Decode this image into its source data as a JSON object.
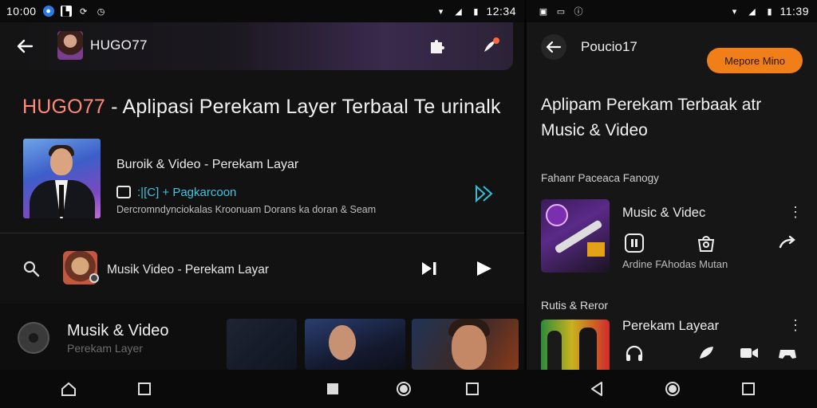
{
  "status_left": {
    "time": "10:00",
    "icons": [
      "messenger-icon",
      "photo-icon",
      "sync-icon",
      "alarm-icon"
    ],
    "right_time": "12:34"
  },
  "status_right": {
    "icons": [
      "image-icon",
      "chat-icon",
      "info-icon"
    ],
    "time": "11:39"
  },
  "left": {
    "topbar_title": "HUGO77",
    "headline_brand": "HUGO77",
    "headline_rest": " - Aplipasi Perekam Layer Terbaal Te urinalk",
    "featured": {
      "title": "Buroik & Video - Perekam Layar",
      "channel": ":|[C]  + Pagkarcoon",
      "description": "Dercromndynciokalas Kroonuam Dorans ka doran & Seam"
    },
    "row": {
      "title": "Musik Video - Perekam Layar"
    },
    "strip": {
      "title": "Musik & Video",
      "subtitle": "Perekam Layer"
    }
  },
  "right": {
    "title": "Poucio17",
    "pill_label": "Mepore Mino",
    "headline_line1": "Aplipam Perekam Terbaak atr",
    "headline_line2": "Music & Video",
    "section1": "Fahanr Paceaca Fanogy",
    "item1": {
      "title": "Music & Videc",
      "label": "Ardine FAhodas Mutan"
    },
    "section2": "Rutis & Reror",
    "item2": {
      "title": "Perekam Layear"
    }
  },
  "colors": {
    "accent_orange": "#f07f1a",
    "brand_red": "#ff8a7a",
    "link_cyan": "#3fc3e0"
  }
}
